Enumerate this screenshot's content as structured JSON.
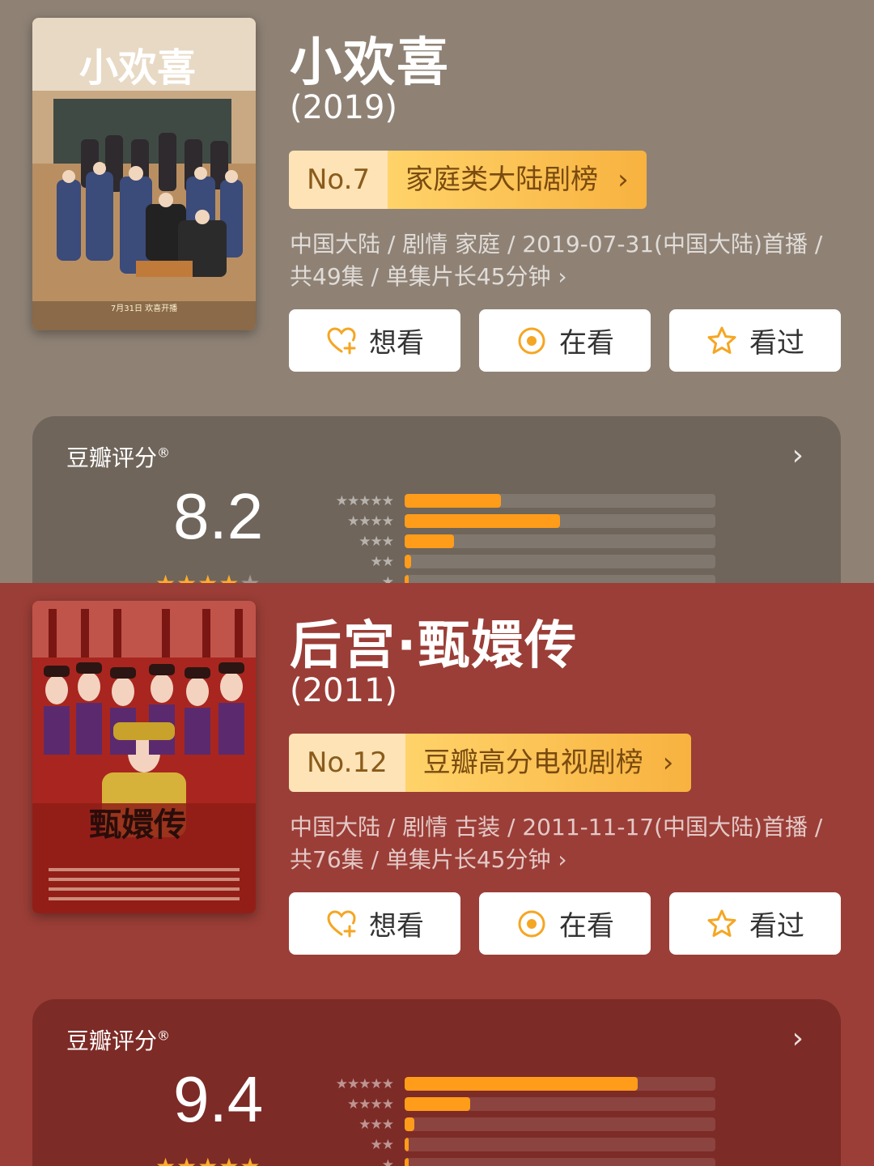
{
  "shows": [
    {
      "title": "小欢喜",
      "year": "(2019)",
      "rank_no": "No.7",
      "rank_list": "家庭类大陆剧榜",
      "meta": "中国大陆 / 剧情 家庭 / 2019-07-31(中国大陆)首播 / 共49集 / 单集片长45分钟",
      "bg_color": "#8f8275",
      "card_color": "#6f655b",
      "poster_title": "小欢喜",
      "poster_date": "7月31日 欢喜开播",
      "rating_label": "豆瓣评分",
      "score": "8.2",
      "stars_on": 4,
      "distribution": [
        0.31,
        0.5,
        0.16,
        0.02,
        0.01
      ]
    },
    {
      "title": "后宫·甄嬛传",
      "year": "(2011)",
      "rank_no": "No.12",
      "rank_list": "豆瓣高分电视剧榜",
      "meta": "中国大陆 / 剧情 古装 / 2011-11-17(中国大陆)首播 / 共76集 / 单集片长45分钟",
      "bg_color": "#9b3e37",
      "card_color": "#7c2b26",
      "poster_title": "甄嬛传",
      "poster_date": "",
      "rating_label": "豆瓣评分",
      "score": "9.4",
      "stars_on": 5,
      "distribution": [
        0.75,
        0.21,
        0.03,
        0.005,
        0.005
      ]
    }
  ],
  "buttons": {
    "want": "想看",
    "watching": "在看",
    "watched": "看过"
  },
  "star_char": "★",
  "chevron": "›",
  "icons": {
    "want": "heart-plus-icon",
    "watching": "target-circle-icon",
    "watched": "star-outline-icon",
    "rating_more": "chevron-right-icon"
  },
  "accent": "#ff9c1a"
}
